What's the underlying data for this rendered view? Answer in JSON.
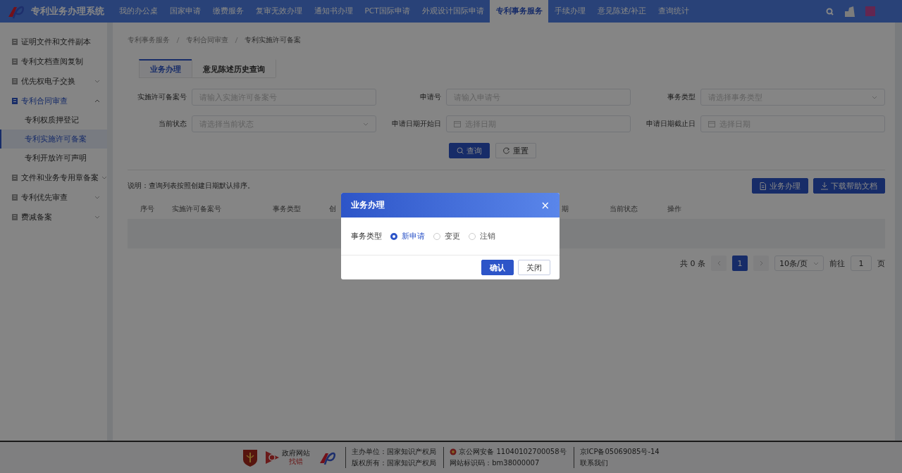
{
  "header": {
    "title": "专利业务办理系统",
    "nav": [
      {
        "label": "我的办公桌",
        "selected": false
      },
      {
        "label": "国家申请",
        "selected": false
      },
      {
        "label": "缴费服务",
        "selected": false
      },
      {
        "label": "复审无效办理",
        "selected": false
      },
      {
        "label": "通知书办理",
        "selected": false
      },
      {
        "label": "PCT国际申请",
        "selected": false
      },
      {
        "label": "外观设计国际申请",
        "selected": false
      },
      {
        "label": "专利事务服务",
        "selected": true
      },
      {
        "label": "手续办理",
        "selected": false
      },
      {
        "label": "意见陈述/补正",
        "selected": false
      },
      {
        "label": "查询统计",
        "selected": false
      }
    ]
  },
  "sidebar": {
    "items": [
      {
        "label": "证明文件和文件副本",
        "kind": "link"
      },
      {
        "label": "专利文档查阅复制",
        "kind": "link"
      },
      {
        "label": "优先权电子交换",
        "kind": "group",
        "expanded": false
      },
      {
        "label": "专利合同审查",
        "kind": "group",
        "expanded": true,
        "children": [
          {
            "label": "专利权质押登记",
            "selected": false
          },
          {
            "label": "专利实施许可备案",
            "selected": true
          },
          {
            "label": "专利开放许可声明",
            "selected": false
          }
        ]
      },
      {
        "label": "文件和业务专用章备案",
        "kind": "group",
        "expanded": false
      },
      {
        "label": "专利优先审查",
        "kind": "group",
        "expanded": false
      },
      {
        "label": "费减备案",
        "kind": "group",
        "expanded": false
      }
    ]
  },
  "breadcrumb": [
    "专利事务服务",
    "专利合同审查",
    "专利实施许可备案"
  ],
  "tabs": [
    {
      "label": "业务办理",
      "selected": true
    },
    {
      "label": "意见陈述历史查询",
      "selected": false
    }
  ],
  "filters": [
    {
      "label": "实施许可备案号",
      "placeholder": "请输入实施许可备案号",
      "kind": "input"
    },
    {
      "label": "申请号",
      "placeholder": "请输入申请号",
      "kind": "input"
    },
    {
      "label": "事务类型",
      "placeholder": "请选择事务类型",
      "kind": "select"
    },
    {
      "label": "当前状态",
      "placeholder": "请选择当前状态",
      "kind": "select"
    },
    {
      "label": "申请日期开始日",
      "placeholder": "选择日期",
      "kind": "date"
    },
    {
      "label": "申请日期截止日",
      "placeholder": "选择日期",
      "kind": "date"
    }
  ],
  "search_buttons": [
    {
      "label": "查询",
      "kind": "primary"
    },
    {
      "label": "重置",
      "kind": "default"
    }
  ],
  "note": "说明：查询列表按照创建日期默认排序。",
  "actions": [
    {
      "label": "业务办理",
      "kind": "document"
    },
    {
      "label": "下载帮助文档",
      "kind": "download"
    }
  ],
  "table": {
    "columns": [
      "序号",
      "实施许可备案号",
      "事务类型",
      "创",
      "期",
      "当前状态",
      "操作"
    ]
  },
  "pagination": {
    "total": "共 0 条",
    "pages": [
      {
        "label": "1",
        "selected": true
      }
    ],
    "page_size": "10条/页",
    "goto_label": "前往",
    "goto_value": "1",
    "goto_suffix": "页"
  },
  "dialog": {
    "title": "业务办理",
    "close": "×",
    "field_label": "事务类型",
    "options": [
      {
        "label": "新申请",
        "selected": true
      },
      {
        "label": "变更",
        "selected": false
      },
      {
        "label": "注销",
        "selected": false
      }
    ],
    "buttons": [
      {
        "label": "确认",
        "kind": "primary"
      },
      {
        "label": "关闭",
        "kind": "default"
      }
    ]
  },
  "footer": {
    "badge_text": [
      "政府网站",
      "找错"
    ],
    "lines": [
      [
        "主办单位：国家知识产权局",
        "版权所有：国家知识产权局"
      ],
      [
        "京公网安备 11040102700058号",
        "网站标识码：bm38000007"
      ],
      [
        "京ICP备05069085号-14",
        "联系我们"
      ]
    ]
  }
}
